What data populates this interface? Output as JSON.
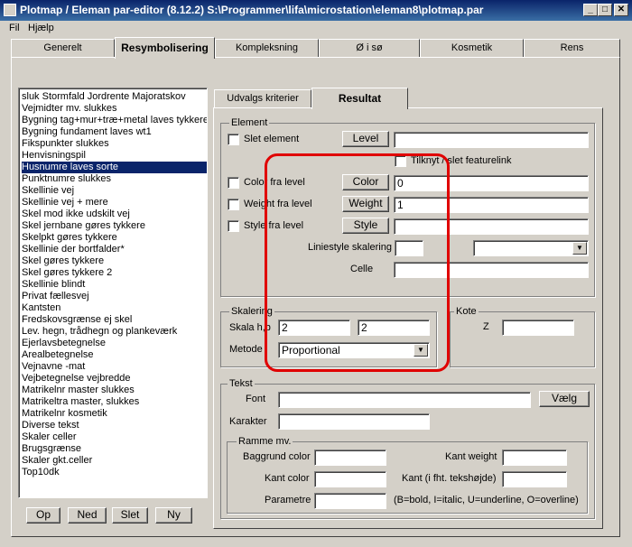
{
  "window": {
    "title": "Plotmap / Eleman par-editor (8.12.2) S:\\Programmer\\lifa\\microstation\\eleman8\\plotmap.par",
    "minimize": "_",
    "maximize": "□",
    "close": "✕"
  },
  "menu": [
    "Fil",
    "Hjælp"
  ],
  "tabs": [
    "Generelt",
    "Resymbolisering",
    "Kompleksning",
    "Ø i sø",
    "Kosmetik",
    "Rens"
  ],
  "list_items": [
    "sluk Stormfald Jordrente Majoratskov",
    "Vejmidter mv. slukkes",
    "Bygning tag+mur+træ+metal laves tykkere",
    "Bygning fundament laves wt1",
    "Fikspunkter slukkes",
    "Henvisningspil",
    "Husnumre laves sorte",
    "Punktnumre slukkes",
    "Skellinie vej",
    "Skellinie vej + mere",
    "Skel mod ikke udskilt vej",
    "Skel jernbane gøres tykkere",
    "Skelpkt gøres tykkere",
    "Skellinie der bortfalder*",
    "Skel gøres tykkere",
    "Skel gøres tykkere 2",
    "Skellinie blindt",
    "Privat fællesvej",
    "Kantsten",
    "Fredskovsgrænse ej skel",
    "Lev. hegn, trådhegn og plankeværk",
    "Ejerlavsbetegnelse",
    "Arealbetegnelse",
    "Vejnavne -mat",
    "Vejbetegnelse vejbredde",
    "Matrikelnr master slukkes",
    "Matrikeltra master, slukkes",
    "Matrikelnr kosmetik",
    "Diverse tekst",
    "Skaler celler",
    "Brugsgrænse",
    "Skaler gkt.celler",
    "Top10dk"
  ],
  "selected_index": 6,
  "list_buttons": {
    "up": "Op",
    "down": "Ned",
    "delete": "Slet",
    "new": "Ny"
  },
  "subtabs": [
    "Udvalgs kriterier",
    "Resultat"
  ],
  "element": {
    "legend": "Element",
    "delete_label": "Slet element",
    "level_button": "Level",
    "level_value": "",
    "featurelink_label": "Tilknyt / slet featurelink",
    "color_label": "Color fra level",
    "color_button": "Color",
    "color_value": "0",
    "weight_label": "Weight fra level",
    "weight_button": "Weight",
    "weight_value": "1",
    "style_label": "Style fra level",
    "style_button": "Style",
    "style_value": "",
    "linestyle_label": "Liniestyle skalering",
    "linestyle_value": "",
    "linestyle_combo": "",
    "cell_label": "Celle",
    "cell_value": ""
  },
  "scaling": {
    "legend": "Skalering",
    "scale_label": "Skala h,b",
    "h": "2",
    "b": "2",
    "method_label": "Metode",
    "method_value": "Proportional"
  },
  "kote": {
    "legend": "Kote",
    "z_label": "Z",
    "z_value": ""
  },
  "text": {
    "legend": "Tekst",
    "font_label": "Font",
    "font_value": "",
    "choose_button": "Vælg",
    "chars_label": "Karakter",
    "chars_value": ""
  },
  "frame": {
    "legend": "Ramme mv.",
    "bg_label": "Baggrund color",
    "bg_value": "",
    "edge_weight_label": "Kant weight",
    "edge_weight_value": "",
    "edge_color_label": "Kant color",
    "edge_color_value": "",
    "edge_height_label": "Kant (i fht. tekshøjde)",
    "edge_height_value": "",
    "params_label": "Parametre",
    "params_value": "",
    "params_hint": "(B=bold, I=italic, U=underline, O=overline)"
  },
  "colors": {
    "highlight": "#0a246a",
    "annotation": "#e00000",
    "face": "#d4d0c8"
  }
}
